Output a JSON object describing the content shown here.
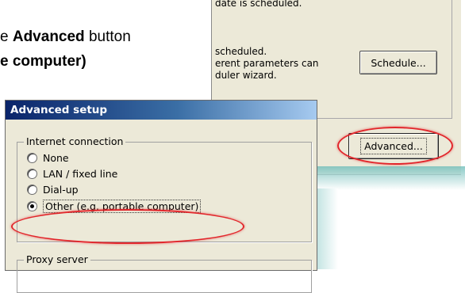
{
  "instruction": {
    "line1_prefix": "e ",
    "line1_bold": "Advanced",
    "line1_suffix": " button",
    "line2_bold": "e computer)"
  },
  "main_window": {
    "text_top": "date is scheduled.",
    "text_scheduled": "scheduled.",
    "text_params": "erent parameters can",
    "text_wizard": "duler wizard.",
    "schedule_button": "Schedule...",
    "advanced_button": "Advanced..."
  },
  "dialog": {
    "title": "Advanced setup",
    "internet_group_label": "Internet connection",
    "options": [
      "None",
      "LAN / fixed line",
      "Dial-up",
      "Other (e.g. portable computer)"
    ],
    "selected_option": "Other (e.g. portable computer)",
    "proxy_group_label": "Proxy server"
  },
  "colors": {
    "highlight": "#e2262b",
    "title_bar_start": "#0a246a",
    "title_bar_end": "#a6caf0",
    "dialog_bg": "#ece9d8"
  }
}
